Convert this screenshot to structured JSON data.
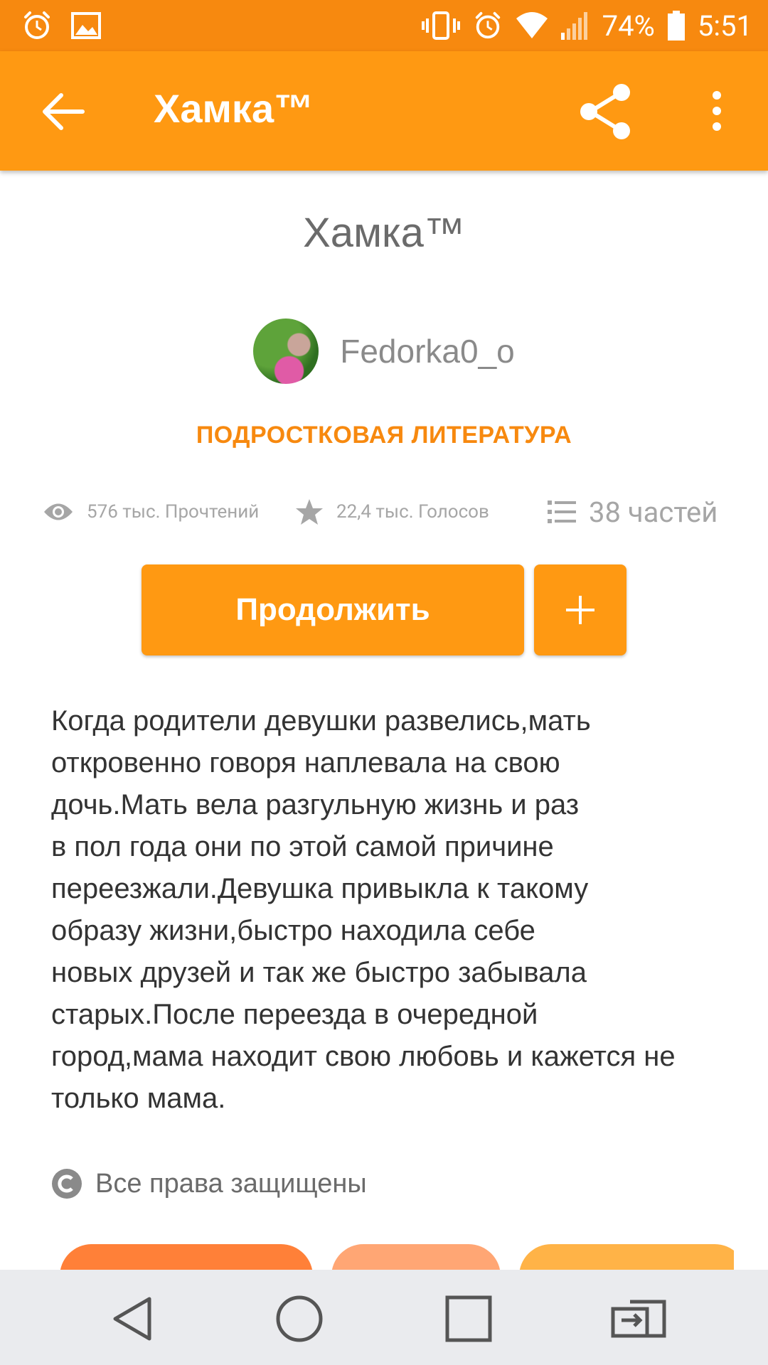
{
  "status_bar": {
    "battery": "74%",
    "time": "5:51"
  },
  "app_bar": {
    "title": "Хамка™"
  },
  "story": {
    "title": "Хамка™",
    "author": "Fedorka0_o",
    "category": "ПОДРОСТКОВАЯ ЛИТЕРАТУРА",
    "stats": {
      "reads": "576 тыс. Прочтений",
      "votes": "22,4 тыс. Голосов",
      "parts": "38 частей"
    },
    "continue_label": "Продолжить",
    "add_label": "+",
    "description": "Когда родители девушки развелись,мать\nоткровенно говоря наплевала на свою\nдочь.Мать вела разгульную жизнь и раз\nв пол года они по этой самой причине\nпереезжали.Девушка привыкла к такому\nобразу жизни,быстро находила себе\nновых друзей и так же быстро забывала\nстарых.После переезда в очередной\nгород,мама находит свою любовь и кажется не\nтолько мама.",
    "copyright": "Все права защищены"
  },
  "icons": {
    "status_left": [
      "alarm-icon",
      "image-icon"
    ],
    "status_right": [
      "vibrate-icon",
      "alarm-icon",
      "wifi-icon",
      "signal-icon",
      "battery-icon"
    ],
    "app_bar": [
      "back-arrow-icon",
      "share-icon",
      "more-vert-icon"
    ],
    "stats": [
      "eye-icon",
      "star-icon",
      "list-icon"
    ],
    "nav": [
      "nav-back-icon",
      "nav-home-icon",
      "nav-recents-icon",
      "nav-switch-icon"
    ]
  },
  "colors": {
    "accent": "#FF9912",
    "status_bar": "#F7890F",
    "tag_colors": [
      "#FF8038",
      "#FFA674",
      "#FFB347"
    ]
  }
}
